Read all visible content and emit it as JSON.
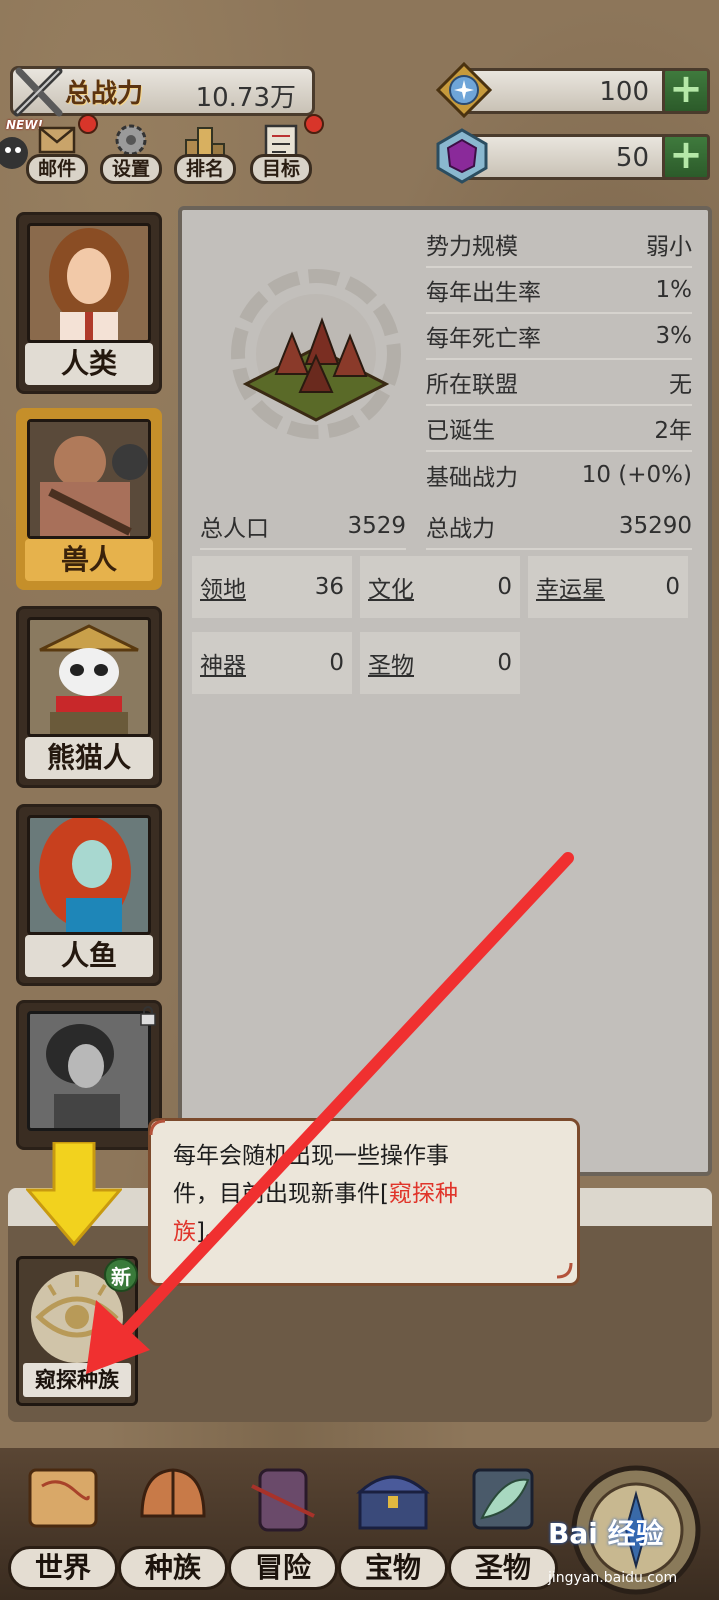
{
  "header": {
    "power_title": "总战力",
    "power_value": "10.73万",
    "resource_1_value": "100",
    "resource_2_value": "50",
    "plus": "+"
  },
  "menu": {
    "new_tag": "NEW!",
    "items": [
      {
        "label": "邮件"
      },
      {
        "label": "设置"
      },
      {
        "label": "排名"
      },
      {
        "label": "目标"
      }
    ]
  },
  "races": [
    {
      "name": "人类"
    },
    {
      "name": "兽人"
    },
    {
      "name": "熊猫人"
    },
    {
      "name": "人鱼"
    },
    {
      "name": ""
    }
  ],
  "stats": {
    "rows": [
      {
        "label": "势力规模",
        "value": "弱小"
      },
      {
        "label": "每年出生率",
        "value": "1%"
      },
      {
        "label": "每年死亡率",
        "value": "3%"
      },
      {
        "label": "所在联盟",
        "value": "无"
      },
      {
        "label": "已诞生",
        "value": "2年"
      },
      {
        "label": "基础战力",
        "value": "10 (+0%)"
      }
    ],
    "population_label": "总人口",
    "population_value": "3529",
    "total_power_label": "总战力",
    "total_power_value": "35290",
    "cells": [
      {
        "label": "领地",
        "value": "36"
      },
      {
        "label": "文化",
        "value": "0"
      },
      {
        "label": "幸运星",
        "value": "0"
      },
      {
        "label": "神器",
        "value": "0"
      },
      {
        "label": "圣物",
        "value": "0"
      }
    ]
  },
  "event": {
    "label": "窥探种族",
    "new_badge": "新"
  },
  "tooltip": {
    "line1": "每年会随机出现一些操作事",
    "line2a": "件，目前出现新事件[",
    "line2b": "窥探种",
    "line3a": "族",
    "line3b": "]。"
  },
  "nav": [
    {
      "label": "世界"
    },
    {
      "label": "种族"
    },
    {
      "label": "冒险"
    },
    {
      "label": "宝物"
    },
    {
      "label": "圣物"
    }
  ],
  "watermark": {
    "text": "Bai 经验",
    "sub": "jingyan.baidu.com"
  },
  "colors": {
    "accent_gold": "#e6b24c",
    "plus_green": "#3f7a3d",
    "highlight_red": "#e0342a"
  }
}
